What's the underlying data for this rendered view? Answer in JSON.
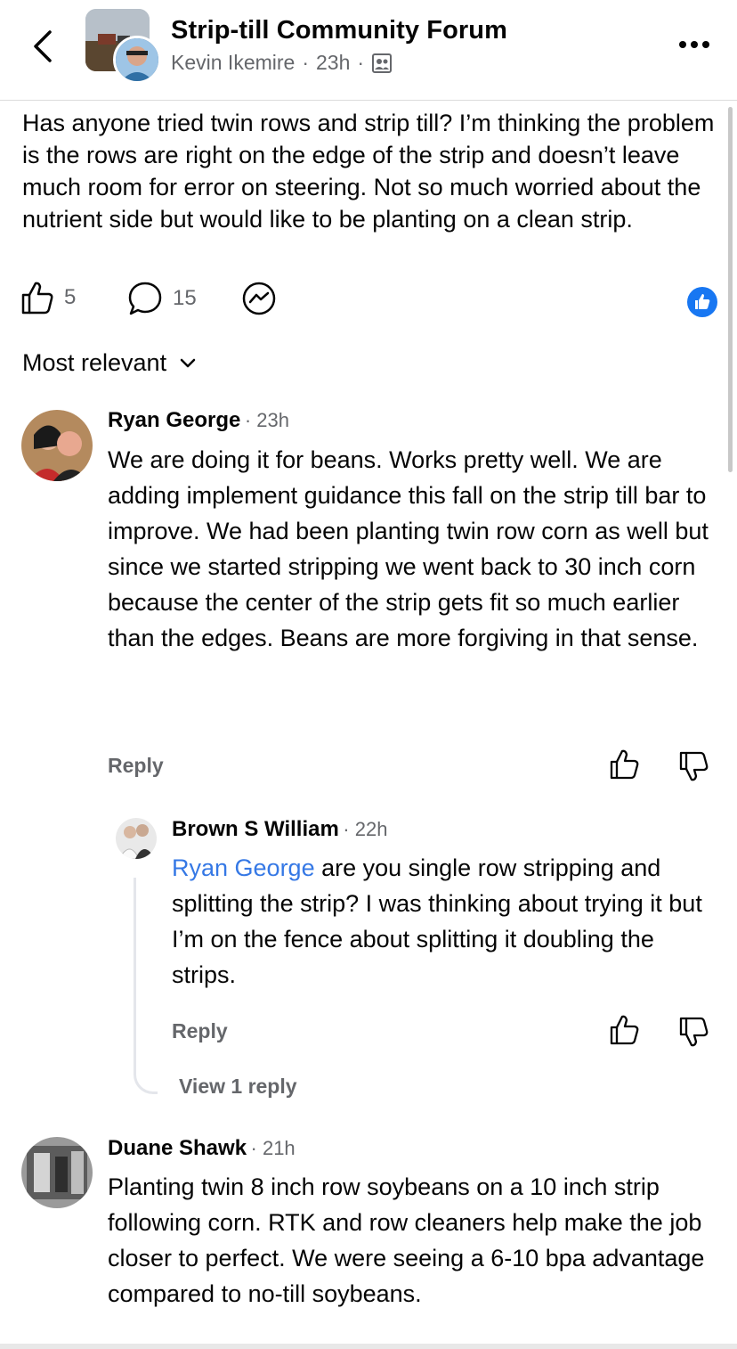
{
  "header": {
    "group_name": "Strip-till Community Forum",
    "author": "Kevin Ikemire",
    "separator": "·",
    "time": "23h",
    "icons": {
      "back": "chevron-left-icon",
      "more": "more-dots-icon",
      "audience": "group-members-icon"
    }
  },
  "post": {
    "text": "Has anyone tried twin rows and strip till?  I’m thinking the problem is the rows are right on the edge of the strip and doesn’t leave much room for error on steering. Not so much worried about the nutrient side but would like to be planting on a clean strip.",
    "likes": "5",
    "comments": "15"
  },
  "sort": {
    "label": "Most relevant"
  },
  "comments": [
    {
      "name": "Ryan George",
      "time": "23h",
      "text": "We are doing it for beans. Works pretty well. We are adding implement guidance this fall on the strip till bar to improve. We had been planting twin row corn as well but since we started stripping we went back to 30 inch corn because the center of the strip gets fit so much earlier than the edges. Beans are more forgiving in that sense.",
      "reply_label": "Reply"
    },
    {
      "name": "Brown S William",
      "time": "22h",
      "mention": "Ryan George",
      "text": " are you single row stripping and splitting the strip?  I was thinking about trying it but I’m on the fence about splitting it doubling the strips.",
      "reply_label": "Reply",
      "view_replies": "View 1 reply"
    },
    {
      "name": "Duane Shawk",
      "time": "21h",
      "text": "Planting twin 8 inch row soybeans on a 10 inch strip following corn. RTK and row cleaners help make the job closer to perfect. We were seeing a 6-10 bpa advantage compared to no-till soybeans."
    }
  ],
  "colors": {
    "accent": "#1877f2",
    "mention": "#3578e5",
    "secondary_text": "#65676b"
  }
}
